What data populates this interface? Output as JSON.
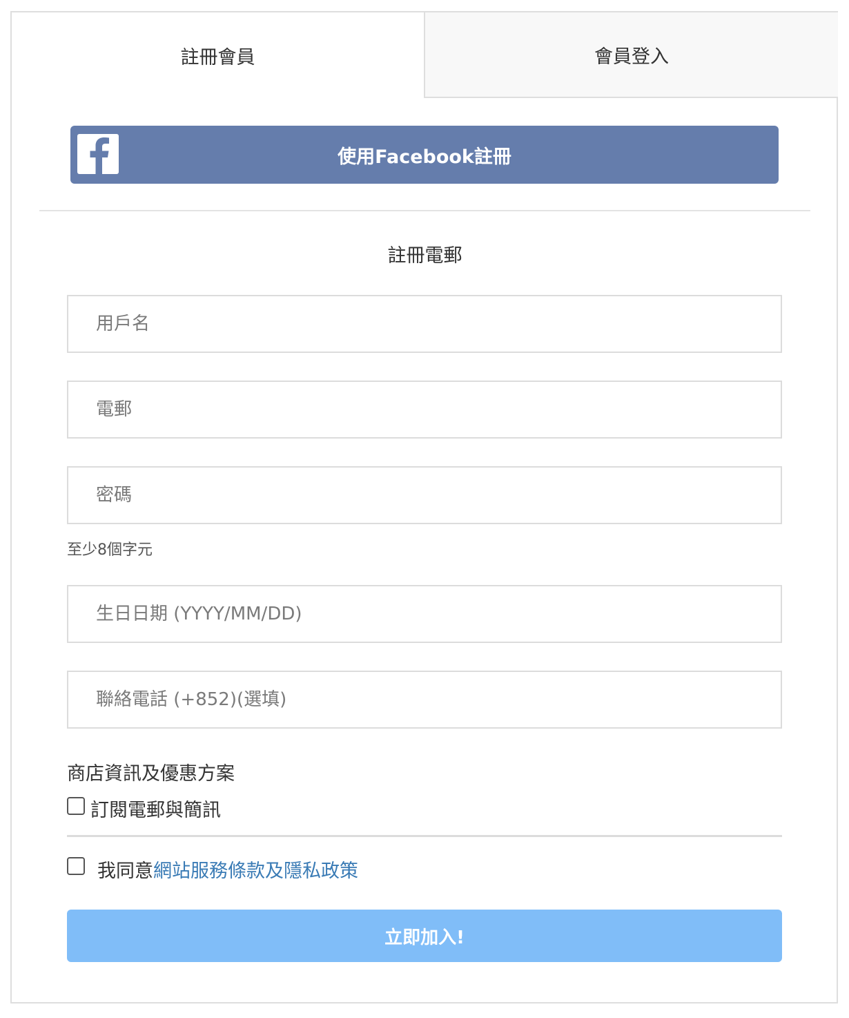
{
  "tabs": {
    "register_label": "註冊會員",
    "login_label": "會員登入"
  },
  "facebook": {
    "label": "使用Facebook註冊",
    "color": "#657dac"
  },
  "form": {
    "section_title": "註冊電郵",
    "username_placeholder": "用戶名",
    "email_placeholder": "電郵",
    "password_placeholder": "密碼",
    "password_hint": "至少8個字元",
    "birthday_placeholder": "生日日期 (YYYY/MM/DD)",
    "phone_placeholder": "聯絡電話 (+852)(選填)"
  },
  "newsletter": {
    "heading": "商店資訊及優惠方案",
    "subscribe_label": "訂閱電郵與簡訊",
    "subscribed": false
  },
  "terms": {
    "prefix": "我同意",
    "link_text": "網站服務條款及隱私政策",
    "agreed": false,
    "link_color": "#3a7bb5"
  },
  "submit": {
    "label": "立即加入!",
    "color": "#80bdf8"
  }
}
